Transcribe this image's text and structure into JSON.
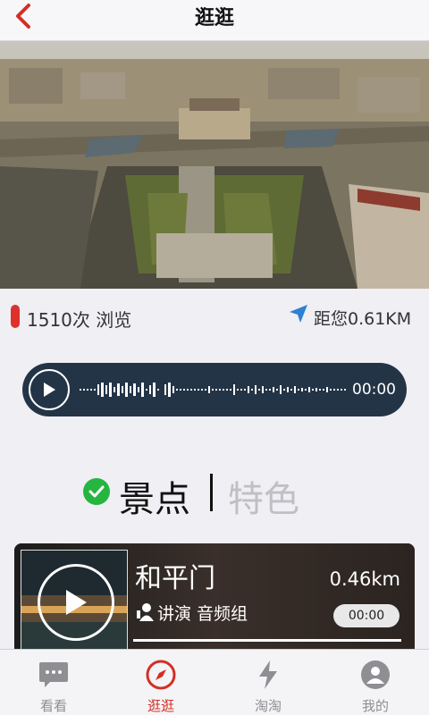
{
  "header": {
    "title": "逛逛"
  },
  "stats": {
    "views": "1510次 浏览",
    "distance": "距您0.61KM"
  },
  "audio": {
    "time": "00:00"
  },
  "segment": {
    "active": "景点",
    "inactive": "特色"
  },
  "card": {
    "name": "和平门",
    "distance": "0.46km",
    "narrator": "讲演 音频组",
    "time": "00:00"
  },
  "tabbar": {
    "items": [
      {
        "label": "看看",
        "icon": "chat-bubble-icon"
      },
      {
        "label": "逛逛",
        "icon": "compass-icon"
      },
      {
        "label": "淘淘",
        "icon": "lightning-icon"
      },
      {
        "label": "我的",
        "icon": "profile-icon"
      }
    ],
    "active_color": "#d22f26",
    "inactive_color": "#8e8e93"
  },
  "colors": {
    "accent_red": "#e0302c",
    "player_bg": "#243447",
    "check_green": "#25b540"
  }
}
